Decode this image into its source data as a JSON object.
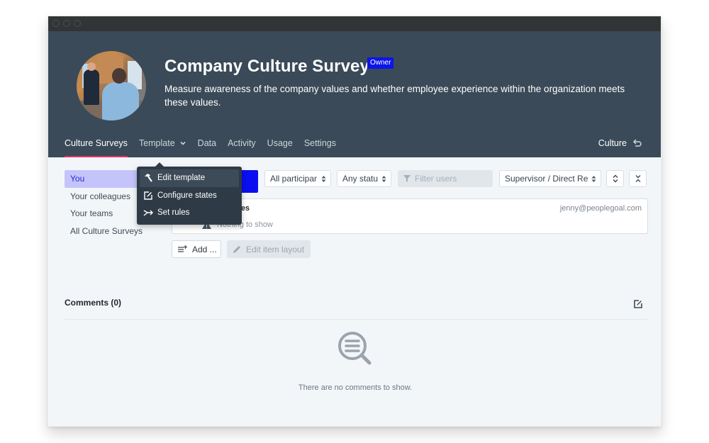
{
  "window": {
    "traffic_lights": [
      "close",
      "minimize",
      "maximize"
    ]
  },
  "header": {
    "title": "Company Culture Survey",
    "badge": "Owner",
    "description": "Measure awareness of the company values and whether employee experience within the organization meets these values.",
    "avatar_icon": "team-photo"
  },
  "tabs": [
    {
      "label": "Culture Surveys",
      "active": true
    },
    {
      "label": "Template",
      "has_dropdown": true
    },
    {
      "label": "Data"
    },
    {
      "label": "Activity"
    },
    {
      "label": "Usage"
    },
    {
      "label": "Settings"
    }
  ],
  "context_link": {
    "label": "Culture",
    "icon": "return-icon"
  },
  "sidebar": {
    "items": [
      {
        "label": "You",
        "active": true
      },
      {
        "label": "Your colleagues"
      },
      {
        "label": "Your teams"
      },
      {
        "label": "All Culture Surveys"
      }
    ]
  },
  "template_menu": {
    "items": [
      {
        "label": "Edit template",
        "icon": "hammer-icon"
      },
      {
        "label": "Configure states",
        "icon": "edit-square-icon"
      },
      {
        "label": "Set rules",
        "icon": "rules-icon"
      }
    ]
  },
  "toolbar": {
    "participants_select": "All participants",
    "status_select": "Any status",
    "filter_placeholder": "Filter users",
    "relationship_select": "Supervisor / Direct Reports",
    "expand_icon": "expand-icon",
    "collapse_icon": "collapse-icon"
  },
  "card": {
    "name_fragment": "nes",
    "email": "jenny@peoplegoal.com",
    "empty_text": "Nothing to show"
  },
  "actions": {
    "add_label": "Add ...",
    "edit_layout_label": "Edit item layout"
  },
  "comments": {
    "title": "Comments (0)",
    "empty_text": "There are no comments to show."
  },
  "colors": {
    "header_bg": "#3a4a58",
    "accent_underline": "#e5326a",
    "owner_badge": "#0b15e8",
    "sidebar_active_bg": "#c4c4fb",
    "menu_bg": "#2e3b47",
    "page_bg": "#f3f6f9"
  }
}
